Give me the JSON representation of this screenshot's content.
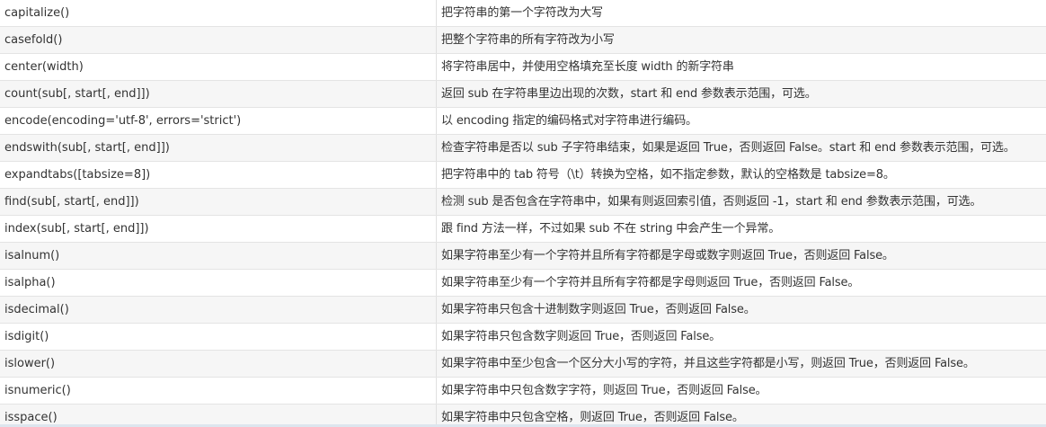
{
  "rows": [
    {
      "method": "capitalize()",
      "description": "把字符串的第一个字符改为大写"
    },
    {
      "method": "casefold()",
      "description": "把整个字符串的所有字符改为小写"
    },
    {
      "method": "center(width)",
      "description": "将字符串居中，并使用空格填充至长度 width 的新字符串"
    },
    {
      "method": "count(sub[, start[, end]])",
      "description": "返回 sub 在字符串里边出现的次数，start 和 end 参数表示范围，可选。"
    },
    {
      "method": "encode(encoding='utf-8', errors='strict')",
      "description": "以 encoding 指定的编码格式对字符串进行编码。"
    },
    {
      "method": "endswith(sub[, start[, end]])",
      "description": "检查字符串是否以 sub 子字符串结束，如果是返回 True，否则返回 False。start 和 end 参数表示范围，可选。"
    },
    {
      "method": "expandtabs([tabsize=8])",
      "description": "把字符串中的 tab 符号（\\t）转换为空格，如不指定参数，默认的空格数是 tabsize=8。"
    },
    {
      "method": "find(sub[, start[, end]])",
      "description": "检测 sub 是否包含在字符串中，如果有则返回索引值，否则返回 -1，start 和 end 参数表示范围，可选。"
    },
    {
      "method": "index(sub[, start[, end]])",
      "description": "跟 find 方法一样，不过如果 sub 不在 string 中会产生一个异常。"
    },
    {
      "method": "isalnum()",
      "description": "如果字符串至少有一个字符并且所有字符都是字母或数字则返回 True，否则返回 False。"
    },
    {
      "method": "isalpha()",
      "description": "如果字符串至少有一个字符并且所有字符都是字母则返回 True，否则返回 False。"
    },
    {
      "method": "isdecimal()",
      "description": "如果字符串只包含十进制数字则返回 True，否则返回 False。"
    },
    {
      "method": "isdigit()",
      "description": "如果字符串只包含数字则返回 True，否则返回 False。"
    },
    {
      "method": "islower()",
      "description": "如果字符串中至少包含一个区分大小写的字符，并且这些字符都是小写，则返回 True，否则返回 False。"
    },
    {
      "method": "isnumeric()",
      "description": "如果字符串中只包含数字字符，则返回 True，否则返回 False。"
    },
    {
      "method": "isspace()",
      "description": "如果字符串中只包含空格，则返回 True，否则返回 False。"
    }
  ]
}
